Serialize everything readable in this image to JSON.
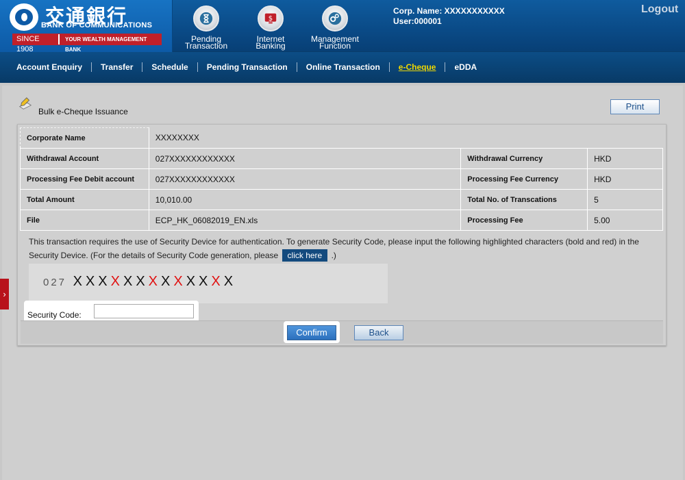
{
  "header": {
    "logo_cn": "交通銀行",
    "logo_en": "BANK OF COMMUNICATIONS",
    "since": "SINCE 1908",
    "tagline": "YOUR WEALTH MANAGEMENT BANK",
    "buttons": [
      {
        "line1": "Pending",
        "line2": "Transaction",
        "icon": "hourglass-icon"
      },
      {
        "line1": "Internet",
        "line2": "Banking",
        "icon": "monitor-dollar-icon"
      },
      {
        "line1": "Management",
        "line2": "Function",
        "icon": "gears-icon"
      }
    ],
    "corp_name": "Corp. Name: XXXXXXXXXXX",
    "user": "User:000001",
    "logout": "Logout"
  },
  "nav": {
    "items": [
      "Account Enquiry",
      "Transfer",
      "Schedule",
      "Pending Transaction",
      "Online Transaction",
      "e-Cheque",
      "eDDA"
    ],
    "active": "e-Cheque"
  },
  "side_tab": "›",
  "page": {
    "title": "Bulk e-Cheque Issuance",
    "print": "Print"
  },
  "details": {
    "corporate_name_label": "Corporate Name",
    "corporate_name": "XXXXXXXX",
    "withdrawal_account_label": "Withdrawal Account",
    "withdrawal_account": "027XXXXXXXXXXXX",
    "withdrawal_currency_label": "Withdrawal Currency",
    "withdrawal_currency": "HKD",
    "fee_debit_account_label": "Processing Fee Debit account",
    "fee_debit_account": "027XXXXXXXXXXXX",
    "fee_currency_label": "Processing Fee Currency",
    "fee_currency": "HKD",
    "total_amount_label": "Total Amount",
    "total_amount": "10,010.00",
    "total_no_label": "Total No. of Transcations",
    "total_no": "5",
    "file_label": "File",
    "file": "ECP_HK_06082019_EN.xls",
    "processing_fee_label": "Processing Fee",
    "processing_fee": "5.00"
  },
  "security": {
    "notice_part1": "This transaction requires the use of Security Device for authentication. To generate Security Code, please input the following highlighted characters (bold and red) in the Security Device. (For the details of Security Code generation, please",
    "click_here": "click here",
    "notice_part2": ".)",
    "code_prefix": "027",
    "code_chars": [
      {
        "ch": "X",
        "red": false
      },
      {
        "ch": "X",
        "red": false
      },
      {
        "ch": "X",
        "red": false
      },
      {
        "ch": "X",
        "red": true
      },
      {
        "ch": "X",
        "red": false
      },
      {
        "ch": "X",
        "red": false
      },
      {
        "ch": "X",
        "red": true
      },
      {
        "ch": "X",
        "red": false
      },
      {
        "ch": "X",
        "red": true
      },
      {
        "ch": "X",
        "red": false
      },
      {
        "ch": "X",
        "red": false
      },
      {
        "ch": "X",
        "red": true
      },
      {
        "ch": "X",
        "red": false
      }
    ],
    "code_label": "Security Code:",
    "code_value": ""
  },
  "actions": {
    "confirm": "Confirm",
    "back": "Back"
  },
  "colors": {
    "header_blue": "#0a4a86",
    "active_nav": "#f0d800",
    "highlight_red": "#e01010",
    "side_tab_red": "#b8121b"
  }
}
